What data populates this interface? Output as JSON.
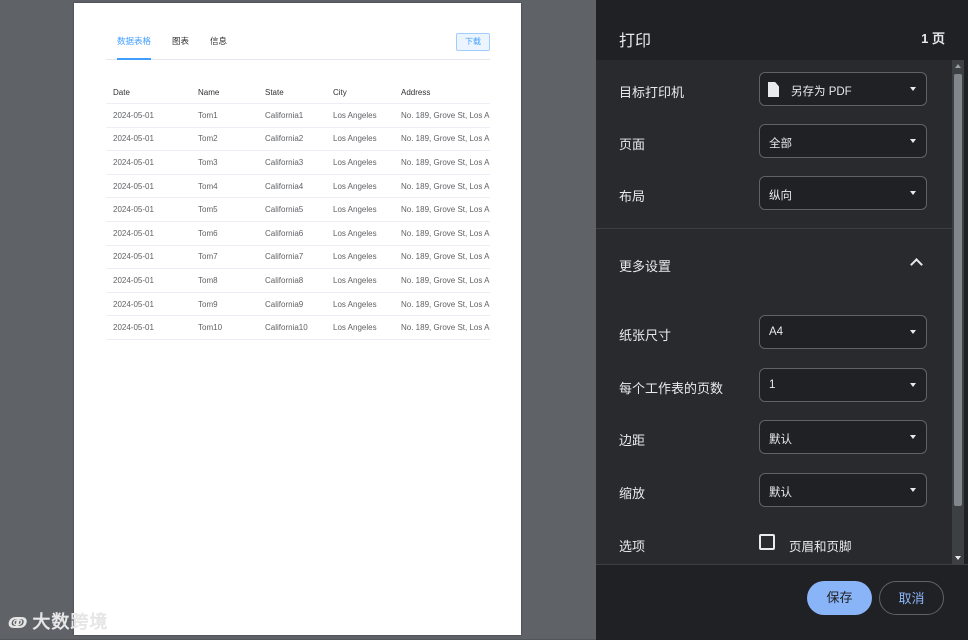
{
  "preview": {
    "tabs": [
      "数据表格",
      "图表",
      "信息"
    ],
    "download_label": "下载",
    "table": {
      "headers": [
        "Date",
        "Name",
        "State",
        "City",
        "Address"
      ],
      "rows": [
        [
          "2024-05-01",
          "Tom1",
          "California1",
          "Los Angeles",
          "No. 189, Grove St, Los A"
        ],
        [
          "2024-05-01",
          "Tom2",
          "California2",
          "Los Angeles",
          "No. 189, Grove St, Los A"
        ],
        [
          "2024-05-01",
          "Tom3",
          "California3",
          "Los Angeles",
          "No. 189, Grove St, Los A"
        ],
        [
          "2024-05-01",
          "Tom4",
          "California4",
          "Los Angeles",
          "No. 189, Grove St, Los A"
        ],
        [
          "2024-05-01",
          "Tom5",
          "California5",
          "Los Angeles",
          "No. 189, Grove St, Los A"
        ],
        [
          "2024-05-01",
          "Tom6",
          "California6",
          "Los Angeles",
          "No. 189, Grove St, Los A"
        ],
        [
          "2024-05-01",
          "Tom7",
          "California7",
          "Los Angeles",
          "No. 189, Grove St, Los A"
        ],
        [
          "2024-05-01",
          "Tom8",
          "California8",
          "Los Angeles",
          "No. 189, Grove St, Los A"
        ],
        [
          "2024-05-01",
          "Tom9",
          "California9",
          "Los Angeles",
          "No. 189, Grove St, Los A"
        ],
        [
          "2024-05-01",
          "Tom10",
          "California10",
          "Los Angeles",
          "No. 189, Grove St, Los A"
        ]
      ]
    },
    "watermark": "大数跨境"
  },
  "print_panel": {
    "title": "打印",
    "page_count": "1 页",
    "destination_label": "目标打印机",
    "destination_value": "另存为 PDF",
    "pages_label": "页面",
    "pages_value": "全部",
    "layout_label": "布局",
    "layout_value": "纵向",
    "more_settings_label": "更多设置",
    "paper_size_label": "纸张尺寸",
    "paper_size_value": "A4",
    "pages_per_sheet_label": "每个工作表的页数",
    "pages_per_sheet_value": "1",
    "margins_label": "边距",
    "margins_value": "默认",
    "scale_label": "缩放",
    "scale_value": "默认",
    "options_label": "选项",
    "headers_footers_label": "页眉和页脚",
    "headers_footers_checked": false,
    "save_label": "保存",
    "cancel_label": "取消"
  },
  "colors": {
    "accent": "#409eff",
    "panel_bg": "#202124",
    "save_button": "#8ab4f8"
  }
}
